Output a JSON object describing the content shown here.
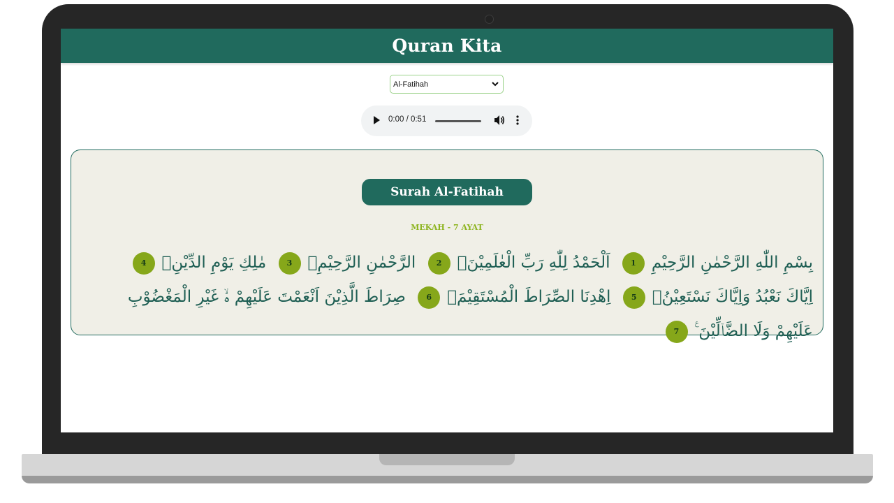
{
  "app": {
    "title": "Quran Kita"
  },
  "surah_select": {
    "selected": "Al-Fatihah"
  },
  "audio": {
    "time": "0:00 / 0:51",
    "progress": 0
  },
  "surah": {
    "title": "Surah Al-Fatihah",
    "meta": "MEKAH - 7 AYAT",
    "ayat": [
      {
        "text": "بِسْمِ اللّٰهِ الرَّحْمٰنِ الرَّحِيْمِ",
        "number": "1"
      },
      {
        "text": "اَلْحَمْدُ لِلّٰهِ رَبِّ الْعٰلَمِيْنَۙ",
        "number": "2"
      },
      {
        "text": "الرَّحْمٰنِ الرَّحِيْمِۙ",
        "number": "3"
      },
      {
        "text": "مٰلِكِ يَوْمِ الدِّيْنِۗ",
        "number": "4"
      },
      {
        "text": "اِيَّاكَ نَعْبُدُ وَاِيَّاكَ نَسْتَعِيْنُۗ",
        "number": "5"
      },
      {
        "text": "اِهْدِنَا الصِّرَاطَ الْمُسْتَقِيْمَۙ",
        "number": "6"
      },
      {
        "text": "صِرَاطَ الَّذِيْنَ اَنْعَمْتَ عَلَيْهِمْ ەۙ غَيْرِ الْمَغْضُوْبِ عَلَيْهِمْ وَلَا الضَّاۤلِّيْنَ ࣖ",
        "number": "7"
      }
    ]
  },
  "colors": {
    "primary": "#206a5d",
    "accent": "#86a71a",
    "card_bg": "#f0efe7",
    "meta_text": "#8db41f"
  },
  "icons": {
    "play": "play-icon",
    "volume": "volume-icon",
    "more": "more-vertical-icon",
    "chevron": "chevron-down-icon"
  }
}
